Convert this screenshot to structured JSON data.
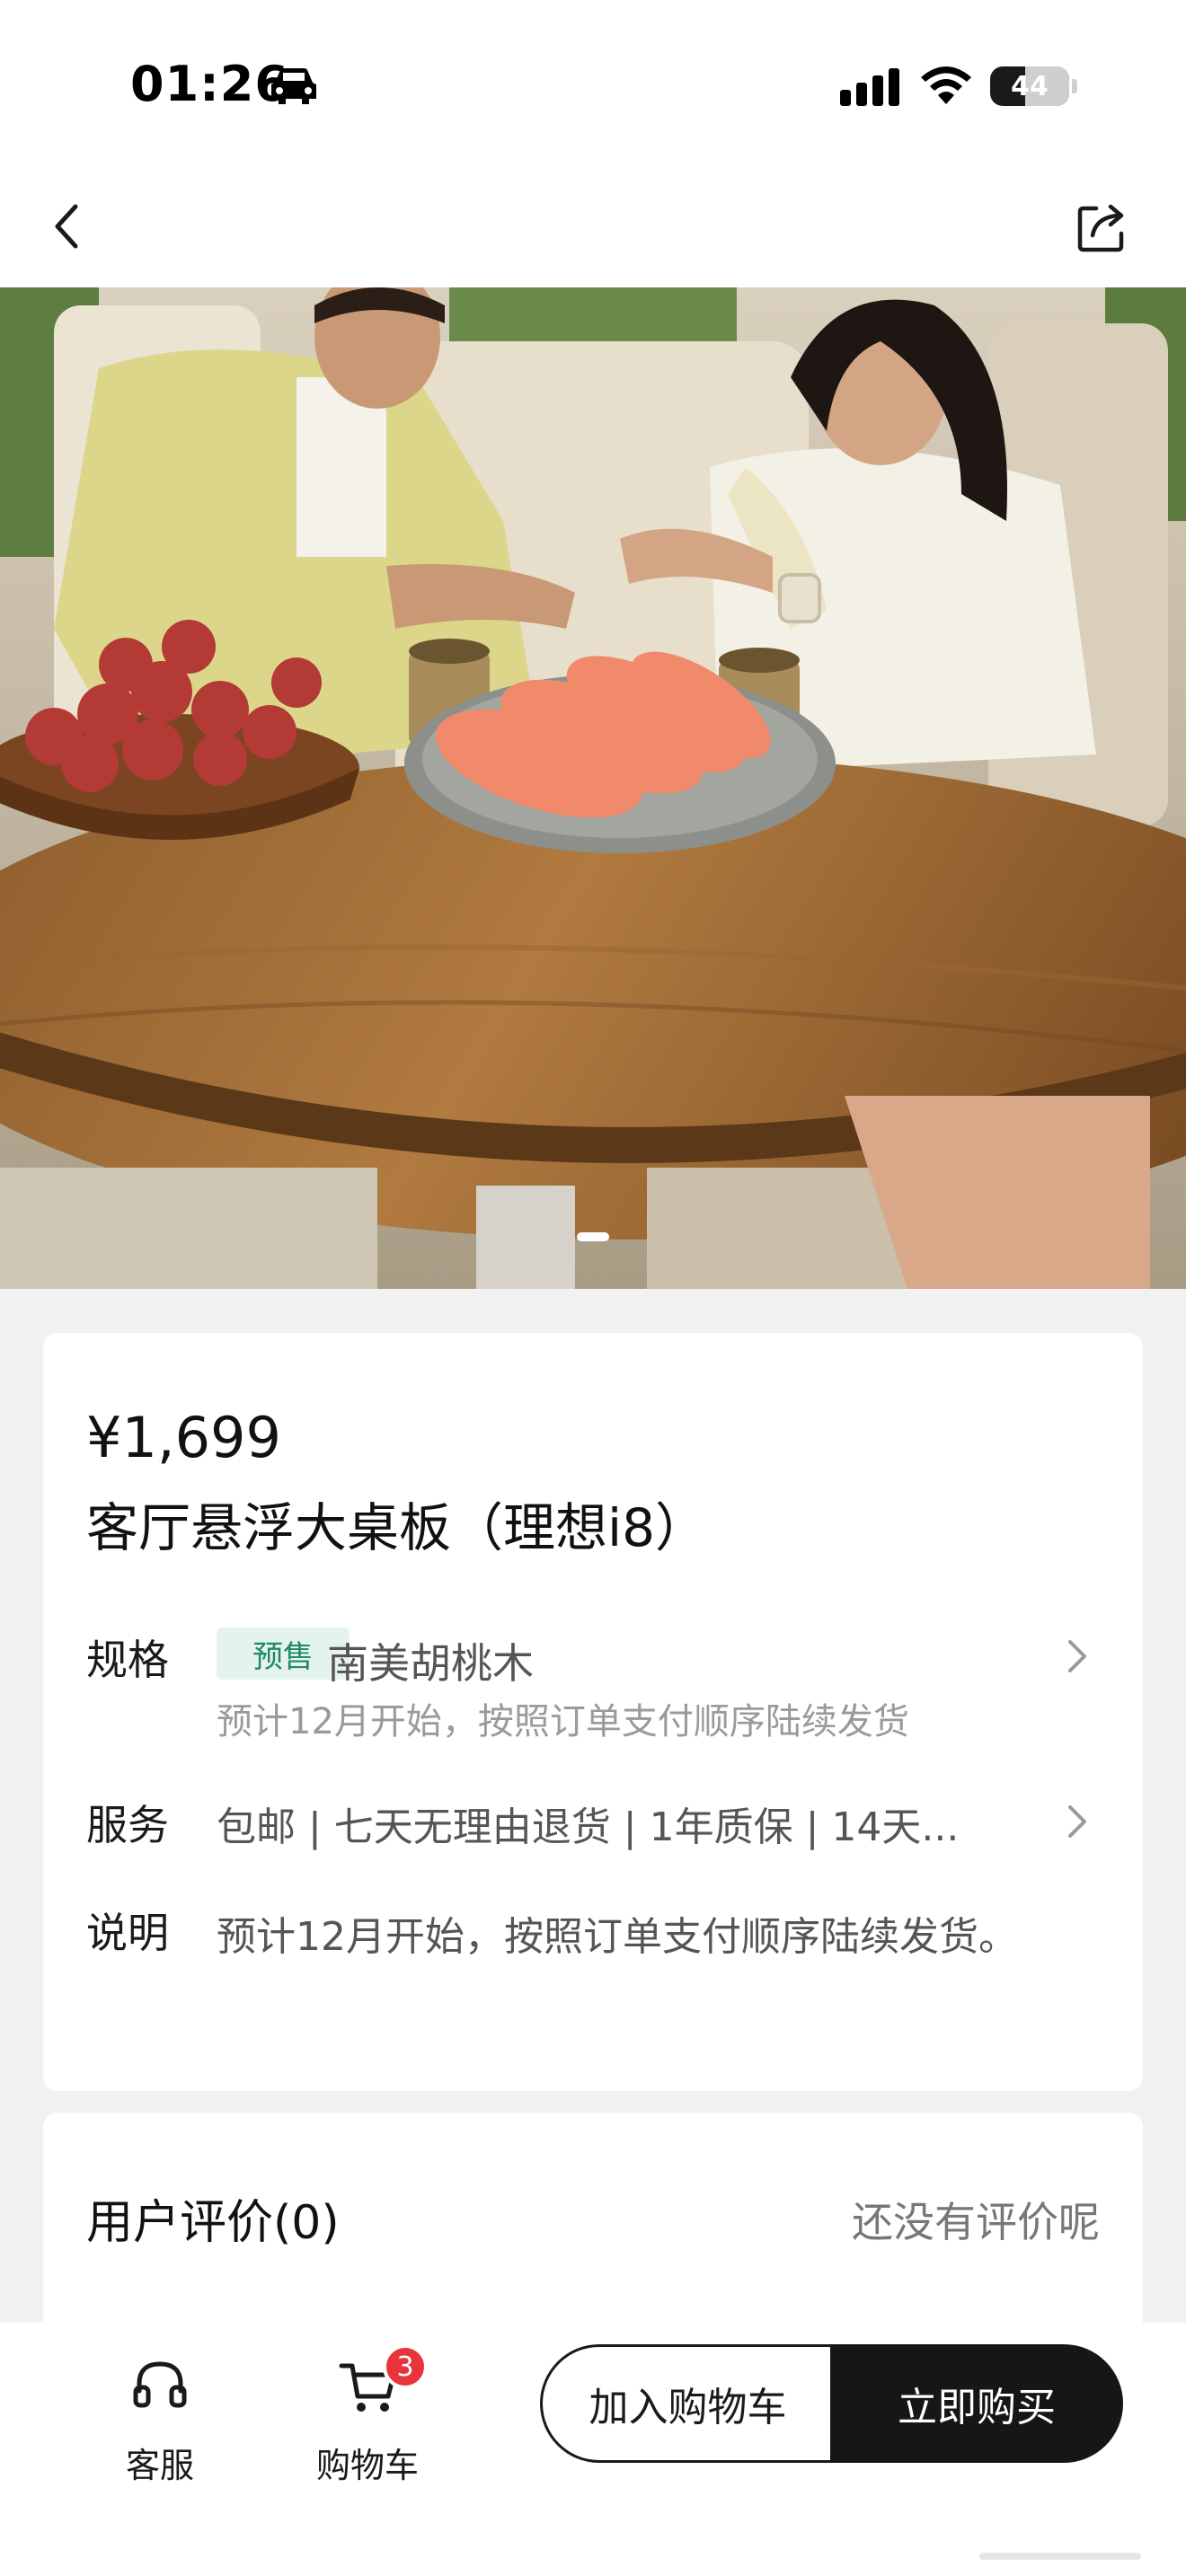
{
  "status_bar": {
    "time": "01:26",
    "battery": "44",
    "battery_level": 0.44
  },
  "nav": {
    "back_icon": "chevron-left-icon",
    "share_icon": "share-icon"
  },
  "hero": {
    "carousel_index": 1,
    "carousel_total": 1
  },
  "product": {
    "price": "¥1,699",
    "title": "客厅悬浮大桌板（理想i8）",
    "spec": {
      "label": "规格",
      "badge": "预售",
      "value": "南美胡桃木",
      "note": "预计12月开始，按照订单支付顺序陆续发货"
    },
    "service": {
      "label": "服务",
      "value": "包邮 | 七天无理由退货 | 1年质保 | 14天..."
    },
    "description": {
      "label": "说明",
      "value": "预计12月开始，按照订单支付顺序陆续发货。"
    }
  },
  "reviews": {
    "title": "用户评价(0)",
    "empty_text": "还没有评价呢"
  },
  "bottom_bar": {
    "service_label": "客服",
    "cart_label": "购物车",
    "cart_count": "3",
    "add_to_cart": "加入购物车",
    "buy_now": "立即购买"
  },
  "colors": {
    "badge_bg": "#e4f3ee",
    "badge_text": "#1f8a66",
    "cart_badge": "#e8343a",
    "buy_button": "#161616"
  }
}
